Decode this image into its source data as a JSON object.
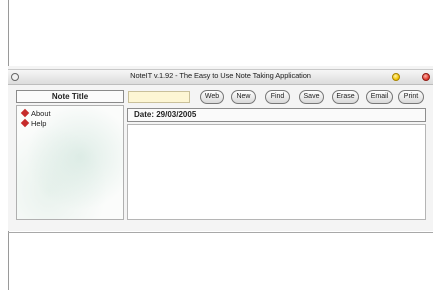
{
  "window": {
    "title": "NoteIT v.1.92 - The Easy to Use Note Taking Application"
  },
  "sidebar": {
    "title": "Note Title",
    "items": [
      {
        "label": "About"
      },
      {
        "label": "Help"
      }
    ]
  },
  "toolbar": {
    "title_input_value": "",
    "buttons": [
      "Web",
      "New",
      "Find",
      "Save",
      "Erase",
      "Email",
      "Print"
    ]
  },
  "date": {
    "label": "Date: 29/03/2005"
  },
  "note": {
    "content": ""
  },
  "colors": {
    "bullet": "#c62b2b",
    "minimize": "#f2c200",
    "close": "#e03a2f",
    "title_input_bg": "#fdf6d4"
  }
}
